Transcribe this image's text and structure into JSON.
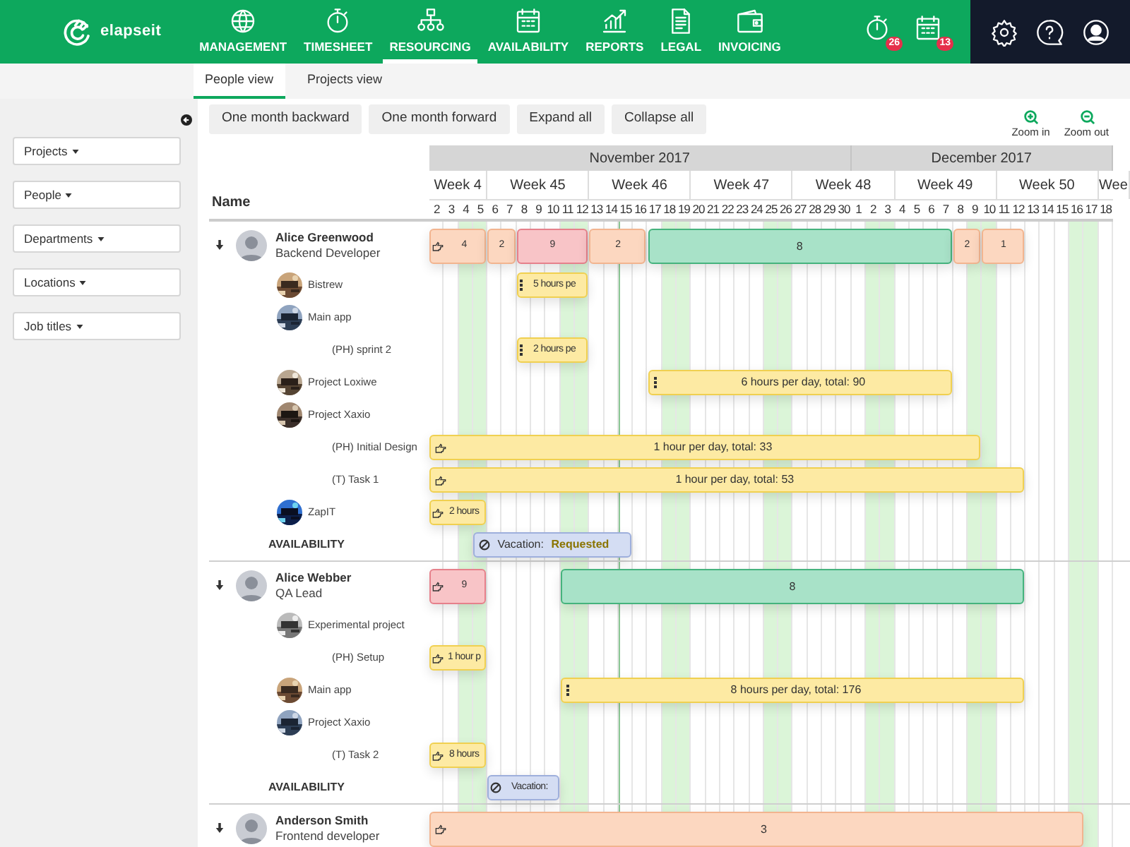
{
  "header": {
    "logo": "elapseit",
    "nav": [
      {
        "label": "MANAGEMENT",
        "kind": "globe",
        "selected": false
      },
      {
        "label": "TIMESHEET",
        "kind": "stopwatch",
        "selected": false
      },
      {
        "label": "RESOURCING",
        "kind": "org",
        "selected": true
      },
      {
        "label": "AVAILABILITY",
        "kind": "calendar",
        "selected": false
      },
      {
        "label": "REPORTS",
        "kind": "chart",
        "selected": false
      },
      {
        "label": "LEGAL",
        "kind": "document",
        "selected": false
      },
      {
        "label": "INVOICING",
        "kind": "wallet",
        "selected": false
      }
    ],
    "badges": [
      {
        "kind": "stopwatch",
        "count": "26"
      },
      {
        "kind": "calendar",
        "count": "13"
      }
    ],
    "actions": [
      {
        "kind": "gear"
      },
      {
        "kind": "help"
      },
      {
        "kind": "user"
      }
    ]
  },
  "subnav": [
    {
      "label": "People view",
      "selected": true
    },
    {
      "label": "Projects view",
      "selected": false
    }
  ],
  "filters": [
    "Projects",
    "People",
    "Departments",
    "Locations",
    "Job titles"
  ],
  "toolbar": [
    "One month backward",
    "One month forward",
    "Expand all",
    "Collapse all"
  ],
  "zoom": [
    {
      "label": "Zoom in",
      "kind": "in"
    },
    {
      "label": "Zoom out",
      "kind": "out"
    }
  ],
  "table": {
    "name_header": "Name",
    "timeline": {
      "months": [
        "November 2017",
        "December 2017"
      ],
      "weeks": [
        "Week 4",
        "Week 45",
        "Week 46",
        "Week 47",
        "Week 48",
        "Week 49",
        "Week 50",
        "Wee"
      ],
      "days": [
        {
          "label": "2",
          "weekend": false,
          "today": false
        },
        {
          "label": "3",
          "weekend": false,
          "today": false
        },
        {
          "label": "4",
          "weekend": true,
          "today": false
        },
        {
          "label": "5",
          "weekend": true,
          "today": false
        },
        {
          "label": "6",
          "weekend": false,
          "today": false
        },
        {
          "label": "7",
          "weekend": false,
          "today": false
        },
        {
          "label": "8",
          "weekend": false,
          "today": false
        },
        {
          "label": "9",
          "weekend": false,
          "today": false
        },
        {
          "label": "10",
          "weekend": false,
          "today": false
        },
        {
          "label": "11",
          "weekend": true,
          "today": false
        },
        {
          "label": "12",
          "weekend": true,
          "today": false
        },
        {
          "label": "13",
          "weekend": false,
          "today": false
        },
        {
          "label": "14",
          "weekend": false,
          "today": false
        },
        {
          "label": "15",
          "weekend": false,
          "today": true
        },
        {
          "label": "16",
          "weekend": false,
          "today": false
        },
        {
          "label": "17",
          "weekend": false,
          "today": false
        },
        {
          "label": "18",
          "weekend": true,
          "today": false
        },
        {
          "label": "19",
          "weekend": true,
          "today": false
        },
        {
          "label": "20",
          "weekend": false,
          "today": false
        },
        {
          "label": "21",
          "weekend": false,
          "today": false
        },
        {
          "label": "22",
          "weekend": false,
          "today": false
        },
        {
          "label": "23",
          "weekend": false,
          "today": false
        },
        {
          "label": "24",
          "weekend": false,
          "today": false
        },
        {
          "label": "25",
          "weekend": true,
          "today": false
        },
        {
          "label": "26",
          "weekend": true,
          "today": false
        },
        {
          "label": "27",
          "weekend": false,
          "today": false
        },
        {
          "label": "28",
          "weekend": false,
          "today": false
        },
        {
          "label": "29",
          "weekend": false,
          "today": false
        },
        {
          "label": "30",
          "weekend": false,
          "today": false
        },
        {
          "label": "1",
          "weekend": false,
          "today": false
        },
        {
          "label": "2",
          "weekend": true,
          "today": false
        },
        {
          "label": "3",
          "weekend": true,
          "today": false
        },
        {
          "label": "4",
          "weekend": false,
          "today": false
        },
        {
          "label": "5",
          "weekend": false,
          "today": false
        },
        {
          "label": "6",
          "weekend": false,
          "today": false
        },
        {
          "label": "7",
          "weekend": false,
          "today": false
        },
        {
          "label": "8",
          "weekend": false,
          "today": false
        },
        {
          "label": "9",
          "weekend": true,
          "today": false
        },
        {
          "label": "10",
          "weekend": true,
          "today": false
        },
        {
          "label": "11",
          "weekend": false,
          "today": false
        },
        {
          "label": "12",
          "weekend": false,
          "today": false
        },
        {
          "label": "13",
          "weekend": false,
          "today": false
        },
        {
          "label": "14",
          "weekend": false,
          "today": false
        },
        {
          "label": "15",
          "weekend": false,
          "today": false
        },
        {
          "label": "16",
          "weekend": true,
          "today": false
        },
        {
          "label": "17",
          "weekend": true,
          "today": false
        },
        {
          "label": "18",
          "weekend": false,
          "today": false
        }
      ]
    },
    "people": [
      {
        "name": "Alice Greenwood",
        "role": "Backend Developer",
        "expanded": true,
        "bars": [
          {
            "kind": "booked",
            "text": "4"
          },
          {
            "kind": "booked",
            "text": "2"
          },
          {
            "kind": "overbooked",
            "text": "9"
          },
          {
            "kind": "booked",
            "text": "2"
          },
          {
            "kind": "available",
            "text": "8"
          },
          {
            "kind": "booked",
            "text": "2"
          },
          {
            "kind": "booked",
            "text": "1"
          }
        ],
        "projects": [
          {
            "name": "Bistrew",
            "bars": [
              {
                "kind": "assignment",
                "text": "5 hours pe"
              }
            ]
          },
          {
            "name": "Main app",
            "children": [
              {
                "name": "(PH) sprint 2",
                "bars": [
                  {
                    "kind": "assignment",
                    "text": "2 hours pe"
                  }
                ]
              }
            ]
          },
          {
            "name": "Project Loxiwe",
            "bars": [
              {
                "kind": "assignment",
                "text": "6 hours per day, total: 90"
              }
            ]
          },
          {
            "name": "Project Xaxio",
            "children": [
              {
                "name": "(PH) Initial Design",
                "bars": [
                  {
                    "kind": "assignment",
                    "text": "1 hour per day, total: 33"
                  }
                ]
              },
              {
                "name": "(T) Task 1",
                "bars": [
                  {
                    "kind": "assignment",
                    "text": "1 hour per day, total: 53"
                  }
                ]
              }
            ]
          },
          {
            "name": "ZapIT",
            "bars": [
              {
                "kind": "assignment",
                "text": "2 hours"
              }
            ]
          }
        ],
        "availability": {
          "label": "AVAILABILITY",
          "bars": [
            {
              "kind": "vacation",
              "text": "Vacation:",
              "status": "Requested"
            }
          ]
        }
      },
      {
        "name": "Alice Webber",
        "role": "QA Lead",
        "expanded": true,
        "bars": [
          {
            "kind": "overbooked",
            "text": "9"
          },
          {
            "kind": "available",
            "text": "8"
          }
        ],
        "projects": [
          {
            "name": "Experimental project",
            "children": [
              {
                "name": "(PH) Setup",
                "bars": [
                  {
                    "kind": "assignment",
                    "text": "1 hour p"
                  }
                ]
              }
            ]
          },
          {
            "name": "Main app",
            "bars": [
              {
                "kind": "assignment",
                "text": "8 hours per day, total: 176"
              }
            ]
          },
          {
            "name": "Project Xaxio",
            "children": [
              {
                "name": "(T) Task 2",
                "bars": [
                  {
                    "kind": "assignment",
                    "text": "8 hours"
                  }
                ]
              }
            ]
          }
        ],
        "availability": {
          "label": "AVAILABILITY",
          "bars": [
            {
              "kind": "vacation",
              "text": "Vacation:"
            }
          ]
        }
      },
      {
        "name": "Anderson Smith",
        "role": "Frontend developer",
        "expanded": true,
        "bars": [
          {
            "kind": "booked",
            "text": "3"
          }
        ]
      }
    ]
  }
}
